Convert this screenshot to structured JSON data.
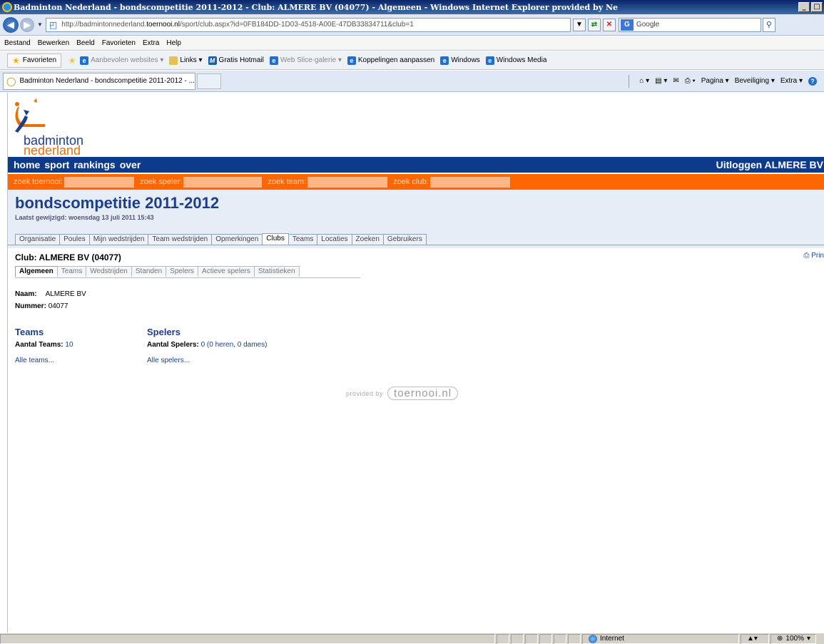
{
  "window": {
    "title": "Badminton Nederland - bondscompetitie 2011-2012 - Club: ALMERE BV (04077) - Algemeen - Windows Internet Explorer provided by Ne",
    "buttons": [
      "_",
      "□"
    ]
  },
  "address": {
    "url_prefix": "http://badmintonnederland.",
    "url_domain": "toernooi.nl",
    "url_suffix": "/sport/club.aspx?id=0FB184DD-1D03-4518-A00E-47DB33834711&club=1",
    "search_engine": "Google",
    "dropdown_glyph": "▼"
  },
  "menu": [
    "Bestand",
    "Bewerken",
    "Beeld",
    "Favorieten",
    "Extra",
    "Help"
  ],
  "favorites": {
    "label": "Favorieten",
    "items": [
      {
        "label": "Aanbevolen websites ▾",
        "icon": "ie",
        "grey": true
      },
      {
        "label": "Links ▾",
        "icon": "folder",
        "grey": false
      },
      {
        "label": "Gratis Hotmail",
        "icon": "msn",
        "grey": false
      },
      {
        "label": "Web Slice-galerie ▾",
        "icon": "ie",
        "grey": true
      },
      {
        "label": "Koppelingen aanpassen",
        "icon": "ie",
        "grey": false
      },
      {
        "label": "Windows",
        "icon": "ie",
        "grey": false
      },
      {
        "label": "Windows Media",
        "icon": "ie",
        "grey": false
      }
    ]
  },
  "tabbar": {
    "tab_title": "Badminton Nederland - bondscompetitie 2011-2012 - ...",
    "commands": [
      "⌂ ▾",
      "▤ ▾",
      "✉",
      "⎙ ▾",
      "Pagina ▾",
      "Beveiliging ▾",
      "Extra ▾"
    ]
  },
  "site": {
    "logo_word1": "badminton",
    "logo_word2": "nederland",
    "nav": [
      "home",
      "sport",
      "rankings",
      "over"
    ],
    "logout": "Uitloggen ALMERE BV",
    "search": [
      "zoek toernooi:",
      "zoek speler:",
      "zoek team:",
      "zoek club:"
    ],
    "title": "bondscompetitie 2011-2012",
    "modified": "Laatst gewijzigd: woensdag 13 juli 2011 15:43",
    "tabs": [
      "Organisatie",
      "Poules",
      "Mijn wedstrijden",
      "Team wedstrijden",
      "Opmerkingen",
      "Clubs",
      "Teams",
      "Locaties",
      "Zoeken",
      "Gebruikers"
    ],
    "active_tab": "Clubs",
    "club_title": "Club: ALMERE BV (04077)",
    "print": "Prin",
    "subtabs": [
      "Algemeen",
      "Teams",
      "Wedstrijden",
      "Standen",
      "Spelers",
      "Actieve spelers",
      "Statistieken"
    ],
    "active_subtab": "Algemeen",
    "naam_label": "Naam:",
    "naam_value": "ALMERE BV",
    "nummer_label": "Nummer:",
    "nummer_value": "04077",
    "teams_heading": "Teams",
    "teams_count_label": "Aantal Teams:",
    "teams_count": "10",
    "teams_all": "Alle teams...",
    "spelers_heading": "Spelers",
    "spelers_count_label": "Aantal Spelers:",
    "spelers_count": "0 (0 heren, 0 dames)",
    "spelers_all": "Alle spelers...",
    "provided_by": "provided by",
    "provided_brand": "toernooi.nl"
  },
  "status": {
    "zone": "Internet",
    "zoom": "100%"
  }
}
